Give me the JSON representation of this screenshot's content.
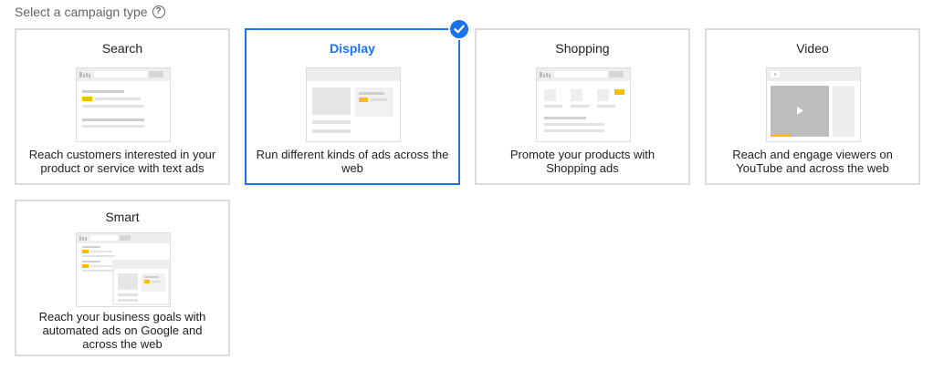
{
  "header": {
    "label": "Select a campaign type",
    "help_symbol": "?"
  },
  "campaigns": [
    {
      "name": "Search",
      "description": "Reach customers interested in your product or service with text ads",
      "selected": false
    },
    {
      "name": "Display",
      "description": "Run different kinds of ads across the web",
      "selected": true
    },
    {
      "name": "Shopping",
      "description": "Promote your products with Shopping ads",
      "selected": false
    },
    {
      "name": "Video",
      "description": "Reach and engage viewers on YouTube and across the web",
      "selected": false
    },
    {
      "name": "Smart",
      "description": "Reach your business goals with automated ads on Google and across the web",
      "selected": false
    }
  ],
  "colors": {
    "accent": "#1a73e8",
    "ad_highlight": "#fbbc04",
    "border": "#dadce0",
    "placeholder": "#e0e0e0"
  }
}
